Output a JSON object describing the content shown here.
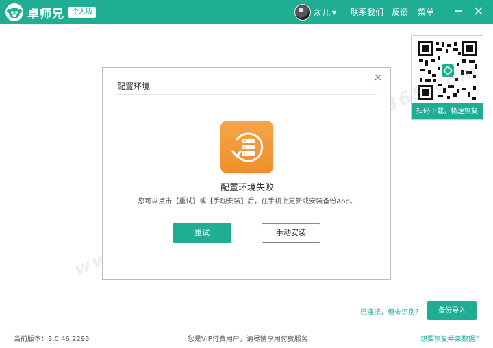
{
  "app": {
    "name": "卓师兄",
    "edition": "个人版"
  },
  "header": {
    "user_name": "灰儿",
    "menu": [
      "联系我们",
      "反馈",
      "菜单"
    ]
  },
  "qr": {
    "caption": "扫码下载，极速恢复"
  },
  "watermark": "www.admin365.com",
  "dialog": {
    "title": "配置环境",
    "heading": "配置环境失败",
    "message": "您可以点击【重试】或【手动安装】后，在手机上更新或安装备份App。",
    "retry_label": "重试",
    "manual_label": "手动安装"
  },
  "status": {
    "connection_text": "已连接，但未识别？",
    "backup_import_label": "备份导入"
  },
  "footer": {
    "version": "当前版本：3.0.46.2293",
    "vip_text": "您是VIP付费用户，请尽情享用付费服务",
    "recover_link": "想要恢复苹果数据？"
  },
  "colors": {
    "accent": "#1fae94",
    "icon_orange": "#f29a35"
  }
}
